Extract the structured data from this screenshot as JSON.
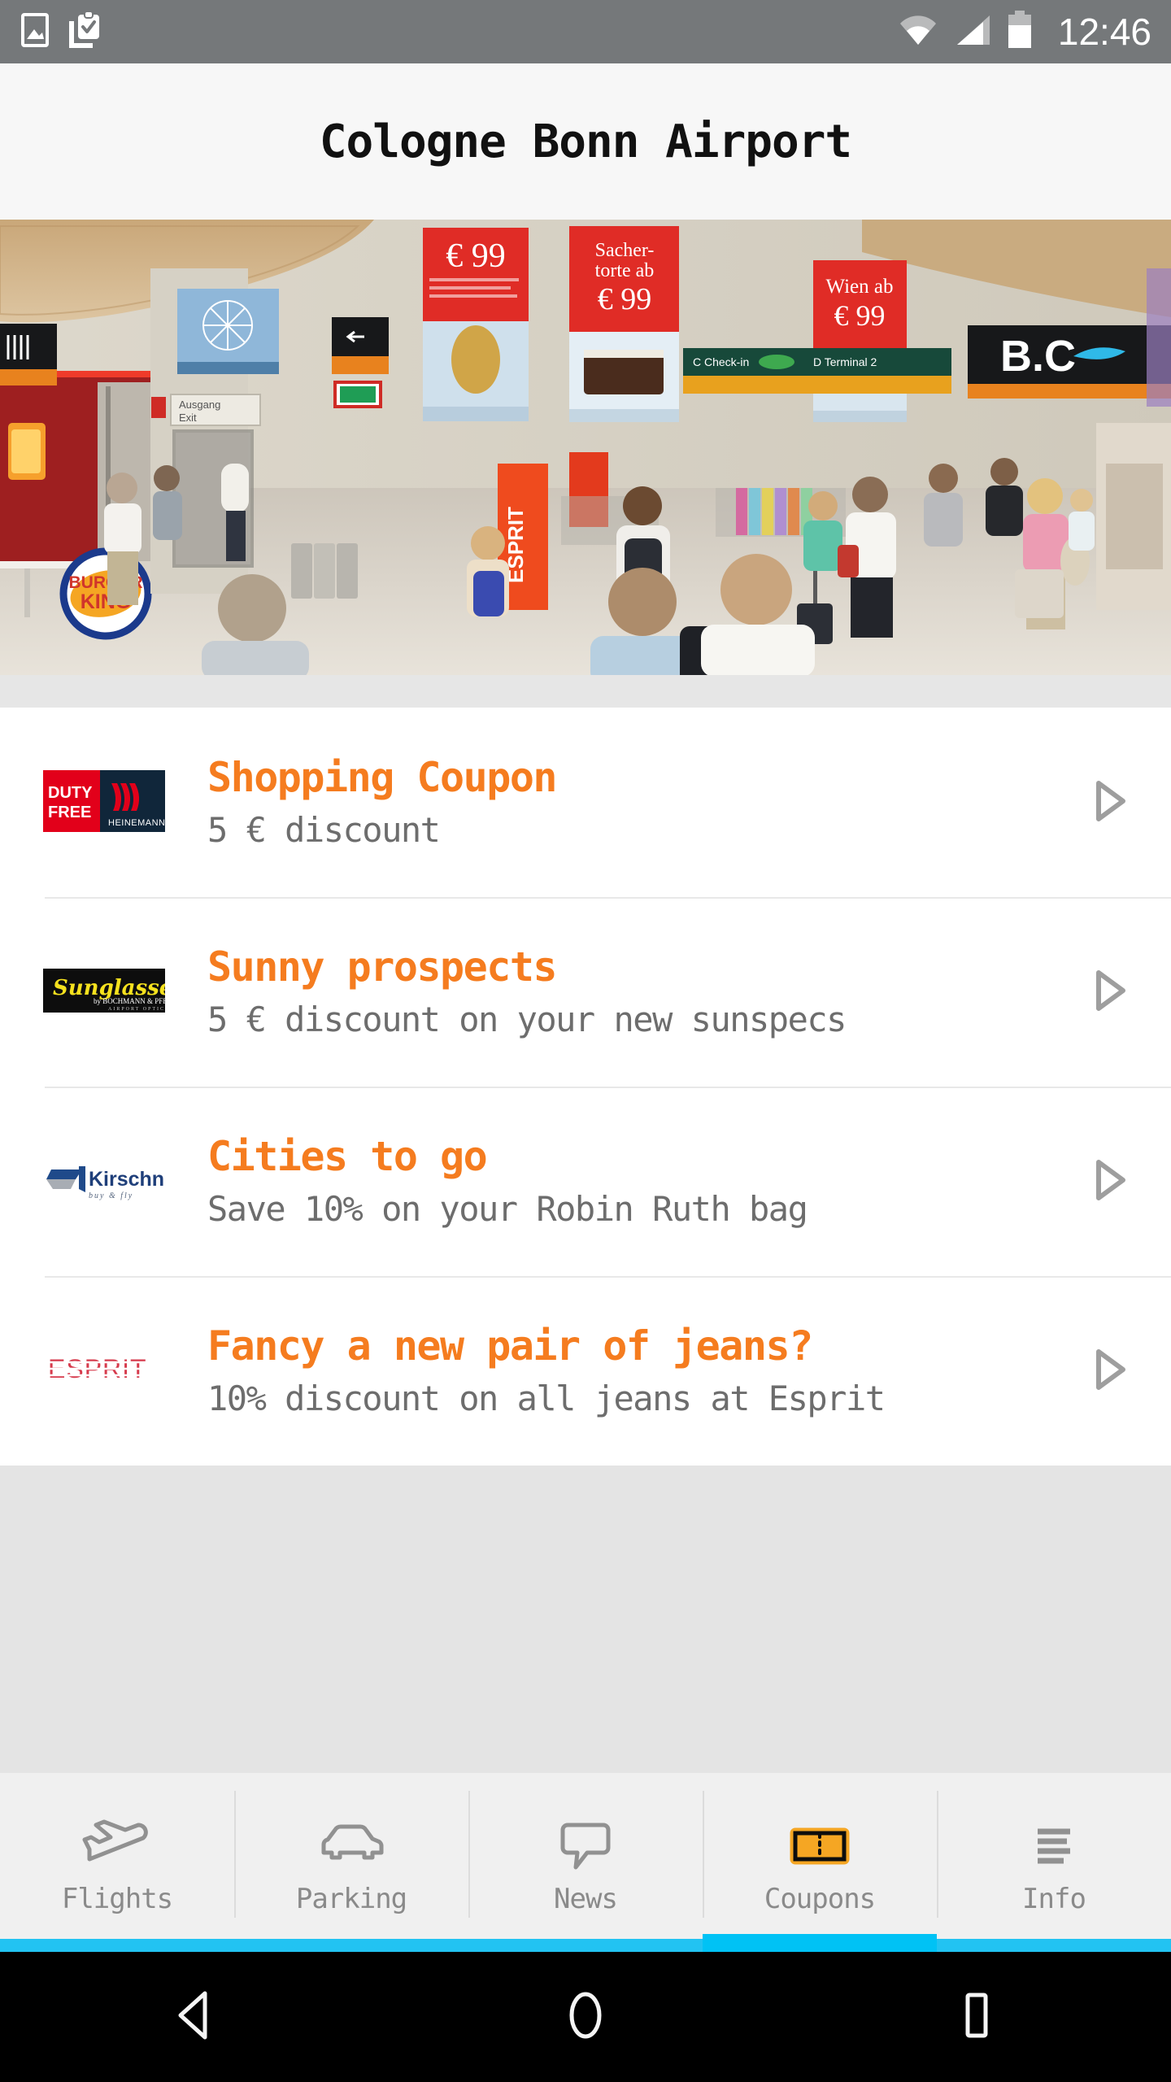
{
  "status_bar": {
    "icons": [
      "image-icon",
      "clipboard-check-icon",
      "wifi-icon",
      "cellular-signal-icon",
      "battery-icon"
    ],
    "time": "12:46",
    "background_color": "#75787a"
  },
  "header": {
    "title": "Cologne Bonn Airport",
    "background_color": "#f7f7f7"
  },
  "hero": {
    "alt": "airport-terminal-concourse-photo",
    "signs": {
      "burger_king": "BURGER KING",
      "exit_de": "Ausgang",
      "exit_en": "Exit",
      "ad_price_1": "€ 99",
      "ad_price_2": "€ 99",
      "ad_text_2": "Sacher-torte ab",
      "ad_text_3": "Wien ab",
      "ad_price_3": "€ 99",
      "gate_sign": "B.C",
      "store_banner": "ESPRIT"
    }
  },
  "coupons": {
    "accent_color": "#f57c1f",
    "subtitle_color": "#6d6d6d",
    "items": [
      {
        "logo": "duty-free-heinemann-logo",
        "logo_text_1": "DUTY",
        "logo_text_2": "FREE",
        "logo_text_3": "HEINEMANN",
        "title": "Shopping Coupon",
        "subtitle": "5 € discount",
        "arrow": "play-arrow-icon"
      },
      {
        "logo": "sunglasses-logo",
        "logo_text_1": "Sunglasses",
        "logo_text_2": "by BOCHMANN & PFENDT",
        "logo_text_3": "AIRPORT OPTIC",
        "title": "Sunny prospects",
        "subtitle": "5 € discount on your new sunspecs",
        "arrow": "play-arrow-icon"
      },
      {
        "logo": "kirschner-logo",
        "logo_text_1": "Kirschner",
        "logo_text_2": "buy & fly",
        "logo_text_3": "",
        "title": "Cities to go",
        "subtitle": "Save 10% on your Robin Ruth bag",
        "arrow": "play-arrow-icon"
      },
      {
        "logo": "esprit-logo",
        "logo_text_1": "ESPRIT",
        "logo_text_2": "",
        "logo_text_3": "",
        "title": "Fancy a new pair of jeans?",
        "subtitle": "10% discount on all jeans at Esprit",
        "arrow": "play-arrow-icon"
      }
    ]
  },
  "tab_bar": {
    "active_index": 3,
    "active_underline_color": "#00c2f5",
    "underline_color": "#22c3f2",
    "tabs": [
      {
        "label": "Flights",
        "icon": "airplane-takeoff-icon"
      },
      {
        "label": "Parking",
        "icon": "car-icon"
      },
      {
        "label": "News",
        "icon": "speech-bubble-icon"
      },
      {
        "label": "Coupons",
        "icon": "ticket-icon"
      },
      {
        "label": "Info",
        "icon": "hamburger-list-icon"
      }
    ]
  },
  "android_nav": {
    "buttons": [
      {
        "name": "back-button",
        "icon": "triangle-back-icon"
      },
      {
        "name": "home-button",
        "icon": "circle-home-icon"
      },
      {
        "name": "recents-button",
        "icon": "square-recents-icon"
      }
    ]
  }
}
